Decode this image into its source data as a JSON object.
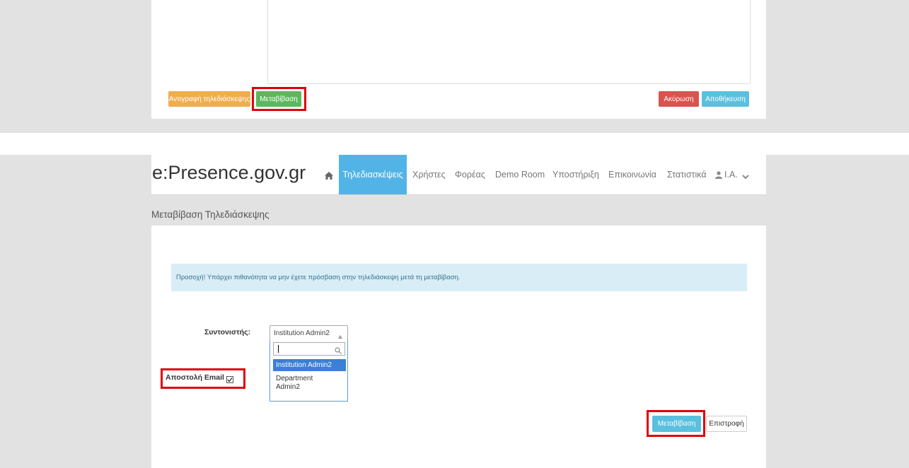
{
  "top_section": {
    "copy_button": "Αντιγραφή τηλεδιάσκεψης",
    "transfer_button": "Μεταβίβαση",
    "cancel_button": "Ακύρωση",
    "save_button": "Αποθήκευση"
  },
  "navbar": {
    "brand": "e:Presence.gov.gr",
    "items": [
      "Τηλεδιασκέψεις",
      "Χρήστες",
      "Φορέας",
      "Demo Room",
      "Υποστήριξη",
      "Επικοινωνία",
      "Στατιστικά"
    ],
    "active_item": "Τηλεδιασκέψεις",
    "user": "I.A."
  },
  "page": {
    "title": "Μεταβίβαση Τηλεδιάσκεψης",
    "alert": "Προσοχή! Υπάρχει πιθανότητα να μην έχετε πρόσβαση στην τηλεδιάσκεψη μετά τη μεταβίβαση.",
    "coordinator_label": "Συντονιστής:",
    "coordinator_selected": "Institution Admin2",
    "search_value": "",
    "options": [
      "Institution Admin2",
      "Department Admin2"
    ],
    "email_label": "Αποστολή Email",
    "email_checked": true,
    "transfer_button": "Μεταβίβαση",
    "back_button": "Επιστροφή"
  },
  "colors": {
    "orange": "#f0ad4e",
    "green": "#5cb85c",
    "red": "#d9534f",
    "blue": "#5bc0de",
    "nav_active": "#52b4e6",
    "alert_bg": "#d9edf7",
    "option_highlight": "#3b7fd6",
    "annotation_red": "#e0000b"
  },
  "icons": [
    "home-icon",
    "user-icon",
    "chevron-down-icon",
    "search-icon",
    "caret-up-icon",
    "checkbox-icon"
  ]
}
